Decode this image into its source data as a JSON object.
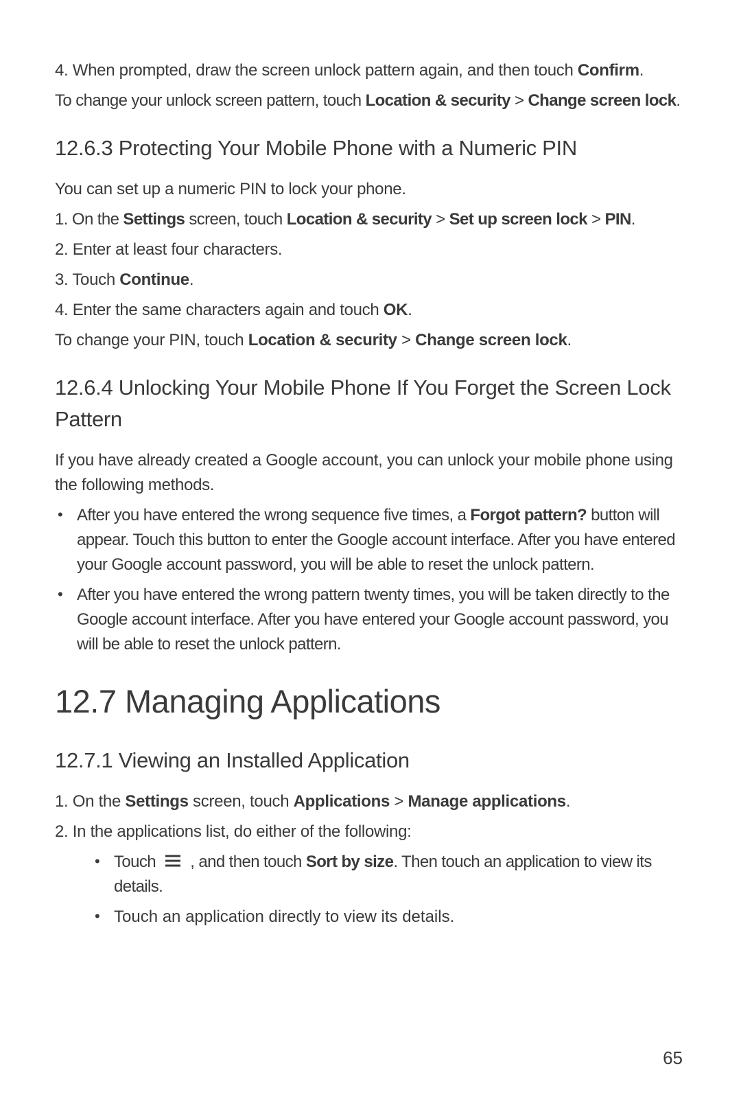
{
  "intro": {
    "step4_pre": "4. When prompted, draw the screen unlock pattern again, and then touch ",
    "step4_bold": "Confirm",
    "step4_post": ".",
    "change_pre": "To change your unlock screen pattern, touch ",
    "change_bold1": "Location & security",
    "change_gt": " > ",
    "change_bold2": "Change screen lock",
    "change_post": "."
  },
  "s1263": {
    "heading": "12.6.3  Protecting Your Mobile Phone with a Numeric PIN",
    "intro": "You can set up a numeric PIN to lock your phone.",
    "step1_pre": "1. On the ",
    "step1_b1": "Settings",
    "step1_mid1": " screen, touch ",
    "step1_b2": "Location & security",
    "step1_gt1": " > ",
    "step1_b3": "Set up screen lock",
    "step1_gt2": " > ",
    "step1_b4": "PIN",
    "step1_post": ".",
    "step2": "2. Enter at least four characters.",
    "step3_pre": "3. Touch ",
    "step3_b": "Continue",
    "step3_post": ".",
    "step4_pre": "4. Enter the same characters again and touch ",
    "step4_b": "OK",
    "step4_post": ".",
    "change_pre": "To change your PIN, touch ",
    "change_b1": "Location & security",
    "change_gt": " > ",
    "change_b2": "Change screen lock",
    "change_post": "."
  },
  "s1264": {
    "heading": "12.6.4  Unlocking Your Mobile Phone If You Forget the Screen Lock Pattern",
    "intro": "If you have already created a Google account, you can unlock your mobile phone using the following methods.",
    "bullet1_pre": "After you have entered the wrong sequence five times, a ",
    "bullet1_b": "Forgot pattern?",
    "bullet1_post": " button will appear. Touch this button to enter the Google account interface. After you have entered your Google account password, you will be able to reset the unlock pattern.",
    "bullet2": "After you have entered the wrong pattern twenty times, you will be taken directly to the Google account interface. After you have entered your Google account password, you will be able to reset the unlock pattern."
  },
  "s127": {
    "heading": "12.7  Managing Applications"
  },
  "s1271": {
    "heading": "12.7.1  Viewing an Installed Application",
    "step1_pre": "1. On the ",
    "step1_b1": "Settings",
    "step1_mid": " screen, touch ",
    "step1_b2": "Applications",
    "step1_gt": " > ",
    "step1_b3": "Manage applications",
    "step1_post": ".",
    "step2": "2. In the applications list, do either of the following:",
    "sub1_pre": "Touch ",
    "sub1_mid": " , and then touch ",
    "sub1_b": "Sort by size",
    "sub1_post": ". Then touch an application to view its details.",
    "sub2": "Touch an application directly to view its details."
  },
  "page_number": "65"
}
